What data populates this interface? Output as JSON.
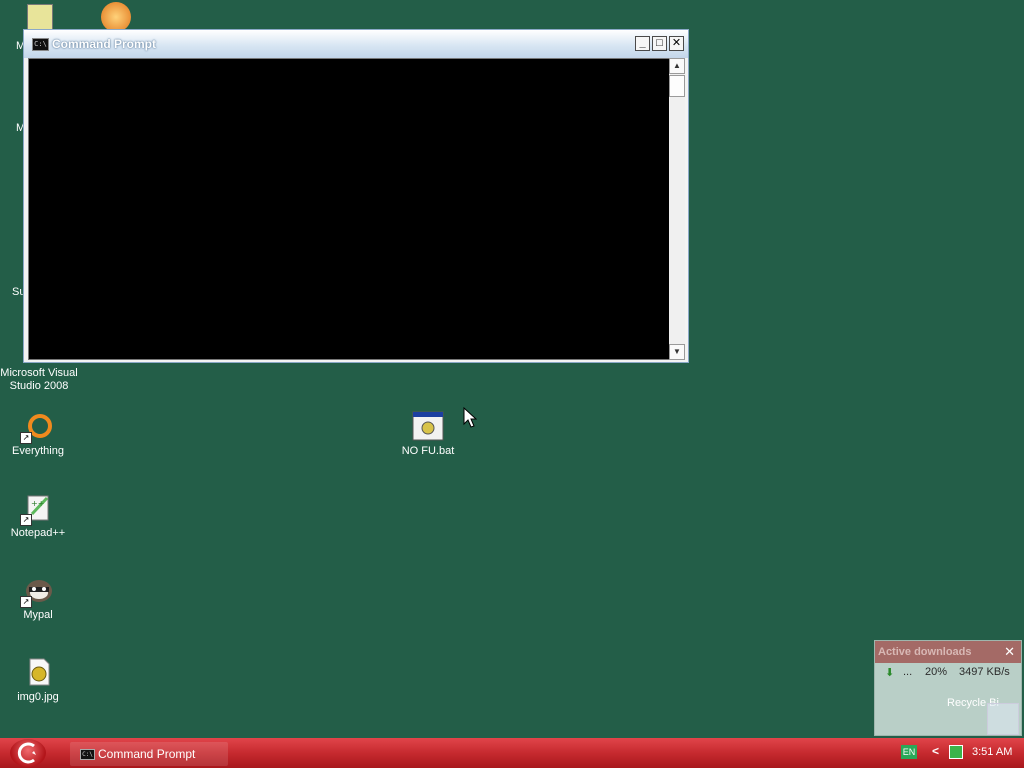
{
  "desktop": {
    "background": "#235e48",
    "icons": [
      {
        "label": "Microsoft Visual Studio 2008",
        "icon": "visual-studio-icon"
      },
      {
        "label": "Everything",
        "icon": "everything-search-icon"
      },
      {
        "label": "Notepad++",
        "icon": "notepad-plus-plus-icon"
      },
      {
        "label": "Mypal",
        "icon": "mypal-browser-icon"
      },
      {
        "label": "img0.jpg",
        "icon": "image-file-icon"
      },
      {
        "label": "NO FU.bat",
        "icon": "batch-file-icon"
      }
    ],
    "partial_labels": {
      "row1": "M",
      "row2": "M",
      "row3": "Su"
    }
  },
  "cmd_window": {
    "title": "Command Prompt",
    "title_icon_text": "C:\\",
    "minimize_glyph": "_",
    "maximize_glyph": "□",
    "close_glyph": "✕",
    "console_background": "#000000",
    "scroll_up_glyph": "▲",
    "scroll_down_glyph": "▼"
  },
  "downloads_widget": {
    "title": "Active downloads",
    "close_glyph": "✕",
    "row": {
      "arrow": "⬇",
      "ellipsis": "...",
      "progress": "20%",
      "speed": "3497 KB/s"
    },
    "overlay_label": "Recycle Bi"
  },
  "taskbar": {
    "task_label": "Command Prompt",
    "language": "EN",
    "chevron": "<",
    "clock": "3:51 AM"
  }
}
